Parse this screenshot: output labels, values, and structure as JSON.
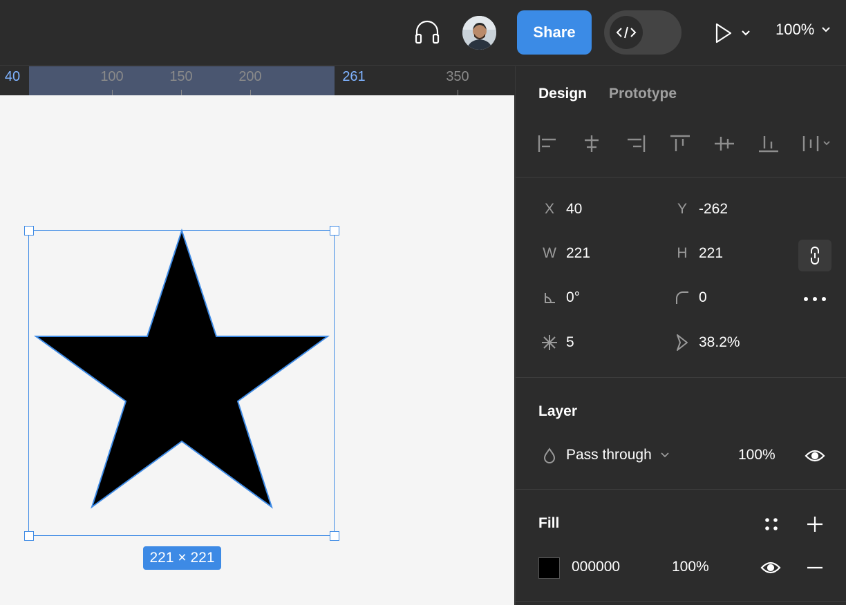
{
  "topbar": {
    "share_label": "Share",
    "zoom_label": "100%"
  },
  "ruler": {
    "start_label": "40",
    "labels": [
      "100",
      "150",
      "200"
    ],
    "end_label": "261",
    "far_label": "350"
  },
  "canvas": {
    "dimension_label": "221 × 221",
    "star_fill": "#000000",
    "selection_color": "#3d8ae5"
  },
  "panel": {
    "tabs": {
      "design": "Design",
      "prototype": "Prototype"
    },
    "props": {
      "x_label": "X",
      "x_value": "40",
      "y_label": "Y",
      "y_value": "-262",
      "w_label": "W",
      "w_value": "221",
      "h_label": "H",
      "h_value": "221",
      "rotation_value": "0°",
      "radius_value": "0",
      "count_value": "5",
      "ratio_value": "38.2%"
    },
    "layer": {
      "title": "Layer",
      "blend_mode": "Pass through",
      "opacity": "100%"
    },
    "fill": {
      "title": "Fill",
      "hex": "000000",
      "opacity": "100%"
    }
  }
}
